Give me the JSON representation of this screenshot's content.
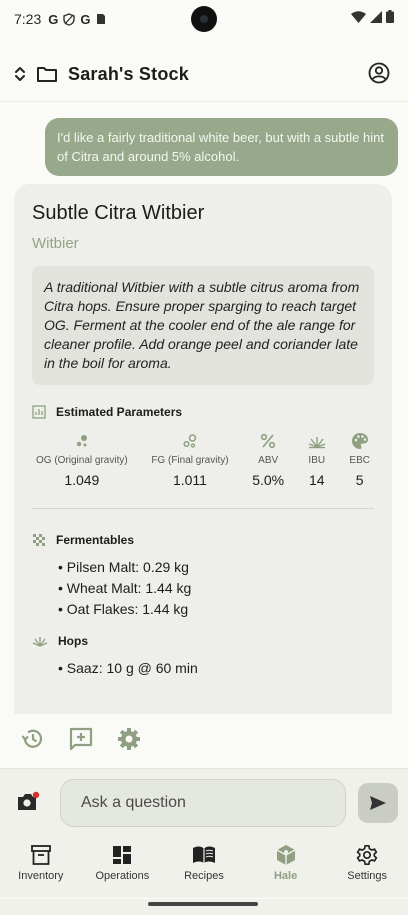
{
  "status_bar": {
    "time": "7:23",
    "notif_icons": [
      "G",
      "G"
    ]
  },
  "app_bar": {
    "title": "Sarah's Stock"
  },
  "chat": {
    "user_message": "I'd like a fairly traditional white beer, but with a subtle hint of Citra and around 5% alcohol.",
    "recipe": {
      "title": "Subtle Citra Witbier",
      "style": "Witbier",
      "description": "A traditional Witbier with a subtle citrus aroma from Citra hops. Ensure proper sparging to reach target OG. Ferment at the cooler end of the ale range for cleaner profile. Add orange peel and coriander late in the boil for aroma.",
      "params_heading": "Estimated Parameters",
      "params": [
        {
          "icon": "og-bubbles-icon",
          "label": "OG (Original gravity)",
          "value": "1.049"
        },
        {
          "icon": "fg-bubbles-icon",
          "label": "FG (Final gravity)",
          "value": "1.011"
        },
        {
          "icon": "percent-icon",
          "label": "ABV",
          "value": "5.0%"
        },
        {
          "icon": "hops-icon",
          "label": "IBU",
          "value": "14"
        },
        {
          "icon": "palette-icon",
          "label": "EBC",
          "value": "5"
        }
      ],
      "fermentables_heading": "Fermentables",
      "fermentables": [
        "• Pilsen Malt: 0.29 kg",
        "• Wheat Malt: 1.44 kg",
        "• Oat Flakes: 1.44 kg"
      ],
      "hops_heading": "Hops",
      "hops": [
        "• Saaz: 10 g @ 60 min"
      ]
    }
  },
  "composer": {
    "placeholder": "Ask a question"
  },
  "nav": {
    "items": [
      {
        "label": "Inventory",
        "icon": "inventory-icon"
      },
      {
        "label": "Operations",
        "icon": "dashboard-icon"
      },
      {
        "label": "Recipes",
        "icon": "book-icon"
      },
      {
        "label": "Hale",
        "icon": "hale-cube-icon",
        "active": true
      },
      {
        "label": "Settings",
        "icon": "gear-icon"
      }
    ]
  },
  "colors": {
    "accent": "#8ea081",
    "user_bubble": "#97a98a",
    "card": "#eeeeea"
  }
}
